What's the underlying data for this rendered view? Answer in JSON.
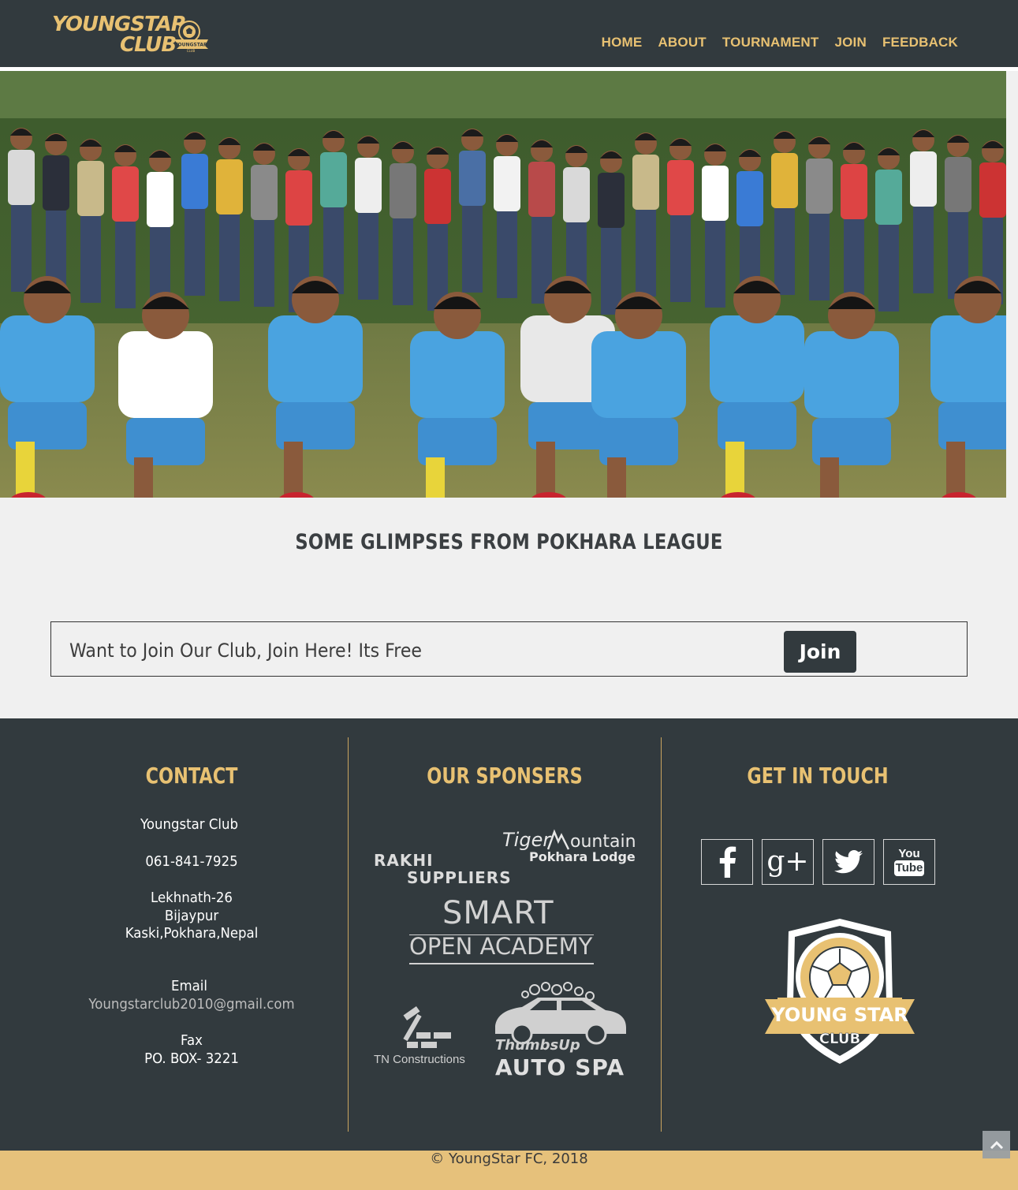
{
  "brand": {
    "line1": "YOUNGSTAR",
    "line2": "CLUB",
    "badge_text": "YOUNGSTAR",
    "badge_sub": "CLUB"
  },
  "nav": {
    "items": [
      "HOME",
      "ABOUT",
      "TOURNAMENT",
      "JOIN",
      "FEEDBACK"
    ]
  },
  "main": {
    "section_title": "SOME GLIMPSES FROM POKHARA LEAGUE",
    "join_text": "Want to Join Our Club, Join Here! Its Free",
    "join_button": "Join"
  },
  "footer": {
    "contact": {
      "title": "CONTACT",
      "name": "Youngstar Club",
      "phone": "061-841-7925",
      "address1": "Lekhnath-26",
      "address2": "Bijaypur",
      "address3": "Kaski,Pokhara,Nepal",
      "email_label": "Email",
      "email": "Youngstarclub2010@gmail.com",
      "fax_label": "Fax",
      "fax": "PO. BOX- 3221"
    },
    "sponsors": {
      "title": "OUR SPONSERS",
      "tiger1": "Tiger",
      "tiger2": "ountain",
      "tiger3": "Pokhara Lodge",
      "rakhi1": "RAKHI",
      "rakhi2": "SUPPLIERS",
      "smart1": "SMART",
      "smart2": "OPEN ACADEMY",
      "tn": "TN Constructions",
      "thumbs1": "ThumbsUp",
      "thumbs2": "AUTO SPA"
    },
    "touch": {
      "title": "GET IN TOUCH",
      "social_icons": [
        "facebook-icon",
        "google-plus-icon",
        "twitter-icon",
        "youtube-icon"
      ],
      "gplus_label": "g+",
      "yt_top": "You",
      "yt_bottom": "Tube",
      "crest_line1": "YOUNG STAR",
      "crest_line2": "CLUB",
      "crest_stars": "★★★"
    },
    "copyright": "© YoungStar FC, 2018"
  },
  "colors": {
    "dark": "#323a3e",
    "gold": "#e8c172",
    "footer_bar": "#e6c17b",
    "page_bg": "#f0f0f0"
  }
}
